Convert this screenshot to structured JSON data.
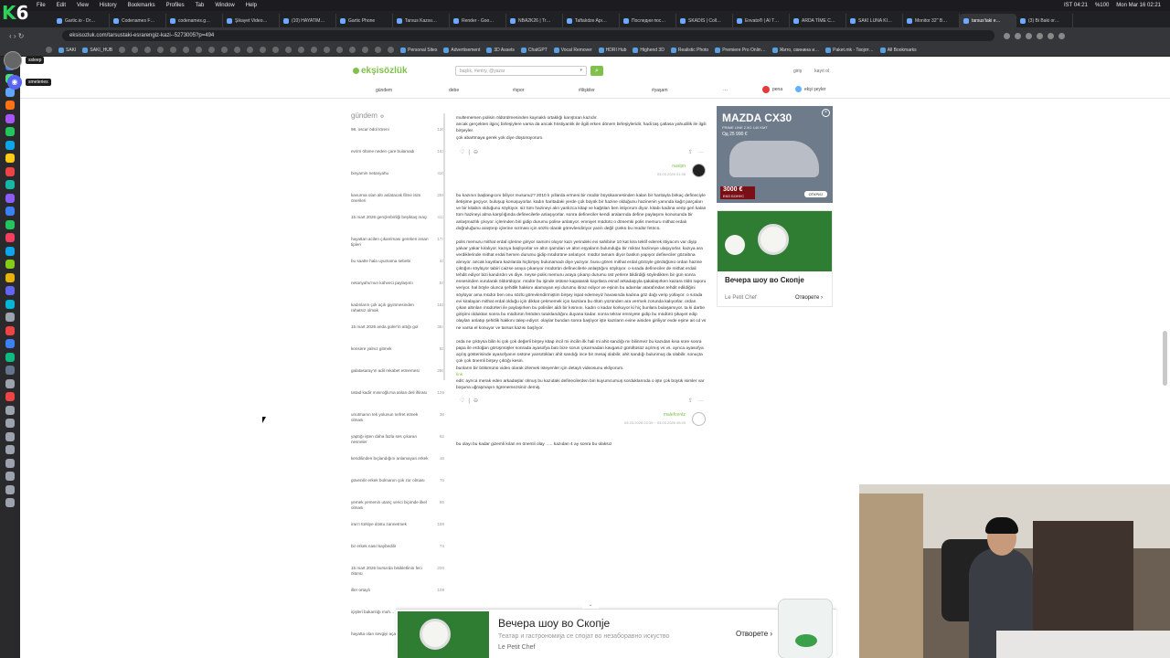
{
  "menubar": {
    "items": [
      "File",
      "Edit",
      "View",
      "History",
      "Bookmarks",
      "Profiles",
      "Tab",
      "Window",
      "Help"
    ],
    "status": "IST 04:21",
    "datetime": "Mon Mar 16  02:21",
    "battery": "%100"
  },
  "tabs": [
    "Gartic.io - Dr…",
    "Codenames F…",
    "codenames.g…",
    "Şikayet Video…",
    "(10) HAYATIM…",
    "Gartic Phone",
    "Tarsus Kazısı…",
    "Render - Goo…",
    "NBA2K26 | Tr…",
    "Taftalıdze Apı…",
    "Последни пос…",
    "SKADIS | Coll…",
    "Envato® | AI T…",
    "ARDA TİME C…",
    "SAKI LUNA KI…",
    "Monitor 32'' B…",
    "tarsus'taki e…",
    "(3) Bi Baki or…"
  ],
  "activeTab": 16,
  "url": "eksisozluk.com/tarsustaki-esrarengiz-kazi--5273005?p=494",
  "bookmarks": [
    "SAKI",
    "SAKI_HUB",
    "Personal Sites",
    "Advertisement",
    "3D Assets",
    "ChatGPT",
    "Vocal Remover",
    "HDRI Hub",
    "Highend 3D",
    "Realistic Photo",
    "Premiere Pro Onlin…",
    "Жито, свинина и…",
    "Paket.mk - Твојот…",
    "All Bookmarks"
  ],
  "chips": {
    "user1": "ssleep",
    "user2": "smeteries"
  },
  "site": {
    "logo": "ekşisözlük",
    "search_placeholder": "başlık, #entry, @yazar",
    "login": "giriş",
    "register": "kayıt ol",
    "nav": [
      "gündem",
      "debe",
      "#spor",
      "#ilişkiler",
      "#yaşam",
      "···"
    ],
    "pena": "pena",
    "eksi_seyler": "ekşi şeyler"
  },
  "sidebar": {
    "title": "gündem",
    "items": [
      {
        "t": "98. oscar ödül töreni",
        "c": "130"
      },
      {
        "t": "evrim ölüme neden çare bulamadı",
        "c": "163"
      },
      {
        "t": "binyamin netanyahu",
        "c": "410"
      },
      {
        "t": "kavurma olan altı anlatacak filme isim önerileri",
        "c": "269"
      },
      {
        "t": "15 mart 2026 gençlerbirliği beşiktaş maçı",
        "c": "413"
      },
      {
        "t": "hayattan acilen çıkarılması gereken insan tipleri",
        "c": "174"
      },
      {
        "t": "bu saatte hala uyumama sebebi",
        "c": "44"
      },
      {
        "t": "netanyahu'nun kahveci paylaşımı",
        "c": "57"
      },
      {
        "t": "kadınların çok açık giyinmesinden rahatsız olmak",
        "c": "181"
      },
      {
        "t": "15 mart 2026 anda güler'in attığı gol",
        "c": "364"
      },
      {
        "t": "konsere yalnız gitmek",
        "c": "83"
      },
      {
        "t": "galatasaray'ın adil rekabet etmemesi",
        "c": "280"
      },
      {
        "t": "üstad kadir mısıroğlu'na atılan deli iftirası",
        "c": "125"
      },
      {
        "t": "unutmanın tek yolunun nefret etmek olması",
        "c": "38"
      },
      {
        "t": "yaptığı işten daha fazla ses çıkaran nesneler",
        "c": "82"
      },
      {
        "t": "kendilinden bıçlandığını anlamayan erkek",
        "c": "18"
      },
      {
        "t": "güvenilir erkek bulmanın çok zor olması",
        "c": "75"
      },
      {
        "t": "yemek yemenin utanç verici biçimde ilkel olması",
        "c": "86"
      },
      {
        "t": "iran'ı türkiye dostu zannetmek",
        "c": "189"
      },
      {
        "t": "bir erkek nasıl kaybedilir",
        "c": "74"
      },
      {
        "t": "15 mart 2026 bursa'da bisikletlinin feci ölümü",
        "c": "200"
      },
      {
        "t": "iller ortaylı",
        "c": "108"
      },
      {
        "t": "içişleri bakanlığı muh… yasağı açıklaması",
        "c": ""
      },
      {
        "t": "hayatta olan sevgiyi açamadan",
        "c": ""
      }
    ]
  },
  "entries": [
    {
      "text": [
        "multememen polisin öldürülmesinden kaynaklı ortaklığı karıştıran kazıdır.",
        "ancak gerçekten ilginç birleşiylere varsa da ancak hristiyanlık ile ilgili erken dönem birleşiyleridir, hadi taş çatlasa yahudilik ile ilgili birşeyler.",
        "çok abartmaya gerek yok diye düşünüyorum."
      ],
      "nick": "nasipn",
      "date": "05.03.2026 01:36"
    },
    {
      "text": [
        "bu kazının başlangıcını biliyor musunuz? 2010 lı yıllarda ermeni bir müdür büyükannesinden kalan bir haritayla birkaç defineciyle iletişime geçiyor. buluşup konuşuyorlar. kadın haritadaki yerde çok büyük bir hazine olduğunu hazinenin yanında kağıt parçaları ve bir kitabın olduğunu söylüyor. siz tüm hazineyi alın yanlızca kitap ve kağıtları ben istiyorum diyor. kitabı kadına verip geri kalan tüm hazineyi alma karşılığında definecilerle anlaşıyorlar. sonra defineciler kendi aralarında define paylaşımı konusunda bir anlaşmazlık çıkıyor. içlerinden biri gidip durumu polise anlatıyor. emniyet müdürü o dönemki polis memuru mithat erdalı doğruluğunu araştırıp içlerine sızması için sözlü olarak görevlendiriyor yazılı değil çünkü bu müdür fetöcü.",
        "polis memuru mithat erdal içlerine giriyor samimi oluyor kazı yerindeki evi sahibine 10 kat kira teklif ederek ittiyacım var diyip yalvar yakar kiralıyor. kazıya başlıyorlar ve altın şamdan ve altın eşyaların bulunduğu bir miktar hazineye ulaşıyorlar. kazıya ara verdiklerinde mithat erdal hemen durumu gidip müdürüne anlatıyor. müdür tamam diyor baskın yapıyor defineciler gözaltına alınıyor. ancak kayıtlara kazılarda hiçbirşey bulunamadı diye yazıyor. bunu gören mithat erdal gözüyle gördüğünü ordan hazine çıktığını söylüyor tabiri caizse araya çıkarıyor müdürün definecilerle anlaştığını söylüyor. o sırada defineciler de mithat erdali tehdit ediyor bizi kandırdın vs diye. neyse polis memuru araya çıkarıp durumu üst yerlere bildirdiği söyledikten bir gün sonra ensesinden vurularak öldürülüyor. müdür bu işinde üstüne kapatarak kayıtlara esnaf arkadaşıyla şakalaşırken kazara öldü raporu veriyor. hal böyle olunca şehitlik hakkını alamayan eşi durumu itiraz ediyor ve eşinin bu adamlar atarafından tehdit edildiğini söylüyor ama müdür ben onu sözlü görevlendirmiştim birşey ispat edemeyiz havasında kadına göz dağı verip yollayor. o sırada evi kiralayan mithat erdal olduğu için dikkat çekmemek için kazılara bu ölüm yüzünden ara vermek zorunda kalıyorlar. ordan çıkan altınları müdürleri ile paylaşırken bu polisiler aldı bir kısmını. kadın o kadar korkuyor ki hiç bunlara bulaşamıyor. ta ki darbe girişimi olduktan sonra bu müdürün fetöden tutuklandığını duyana kadar. sonra tekrar emniyete gidip bu müdürü şikayet edip olayları anlatıp şehitlik hakkını talep ediyor. olaylar bundan sonra başlıyor işte kazıların evine ainiden giriliyor evde eşine ait cd vs ne varsa el konuyor ve tarsus kazısı başlıyor.",
        "orda ne çıktıysa bilin ki çok çok değerli birşey kitap incil mi incilin ilk hali mi ahit sandığı mı bilinmez bu kazıdan kısa süre sonra papa ile erdoğan görüşmüşler sonrada ayasofya batı bize sorun çıkarmadan kavgasız gürültüsüz açılmış vs vs. ayrıca ayasofya açılış gösterisinde ayasofyanın üstüne yansıttıkları ahit sandığı ince bir mesaj olabilir. ahit sandığı bulunmuş da olabilir. sonuçta çok çok önemli birşey çıktığı kesin.",
        "bunların bir bölümünü video olarak izlemek isteyenler için detaylı videosunu ekliyorum.",
        "edit: ayrıca merak eden arkadaşlar olmuş bu kazıdaki definecilerden biri kuyumcumuş sorduklarında o işte çok büyük isimler var boşuna uğraşmayın ögrenemezsiniz demiş."
      ],
      "link": "link",
      "nick": "malefcentz",
      "date": "05.03.2026 03:39 ~ 05.03.2026 05:20"
    },
    {
      "text": [
        "bu olayı bu kadar gizemli kılan en önemli olay ….. kazıdan 4 ay sonra bu olaksız"
      ],
      "nick": "",
      "date": ""
    }
  ],
  "ads": {
    "car": {
      "brand": "MAZDA CX30",
      "sub": "PRIME LINE 2.5G 140 KMT",
      "price": "Од 25 990 €",
      "bonus": "3000 €",
      "bonus_sub": "ЕКО БОНУС",
      "cta": "ОТКРИЈ"
    },
    "food": {
      "title": "Вечера шоу во Скопје",
      "source": "Le Petit Chef",
      "go": "Отворете ›"
    }
  },
  "banner": {
    "title": "Вечера шоу во Скопје",
    "sub": "Театар и гастрономија се спојат во незаборавно искуство",
    "source": "Le Petit Chef",
    "go": "Отворете ›",
    "collapse": "⌄"
  },
  "colors": {
    "brand": "#81c14b",
    "pena": "#e23b3b"
  }
}
